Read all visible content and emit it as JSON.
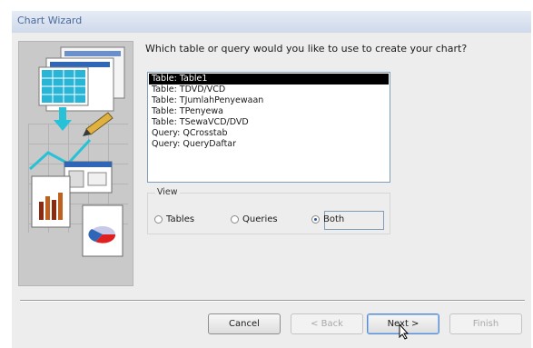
{
  "window": {
    "title": "Chart Wizard"
  },
  "prompt": "Which table or query would you like to use to create your chart?",
  "list": {
    "selected_index": 0,
    "items": [
      "Table: Table1",
      "Table: TDVD/VCD",
      "Table: TJumlahPenyewaan",
      "Table: TPenyewa",
      "Table: TSewaVCD/DVD",
      "Query: QCrosstab",
      "Query: QueryDaftar"
    ]
  },
  "view": {
    "legend": "View",
    "options": [
      "Tables",
      "Queries",
      "Both"
    ],
    "selected": "Both"
  },
  "buttons": {
    "cancel": "Cancel",
    "back": "< Back",
    "next": "Next >",
    "finish": "Finish"
  },
  "colors": {
    "selection": "#000000",
    "accent": "#2a5a9a"
  }
}
